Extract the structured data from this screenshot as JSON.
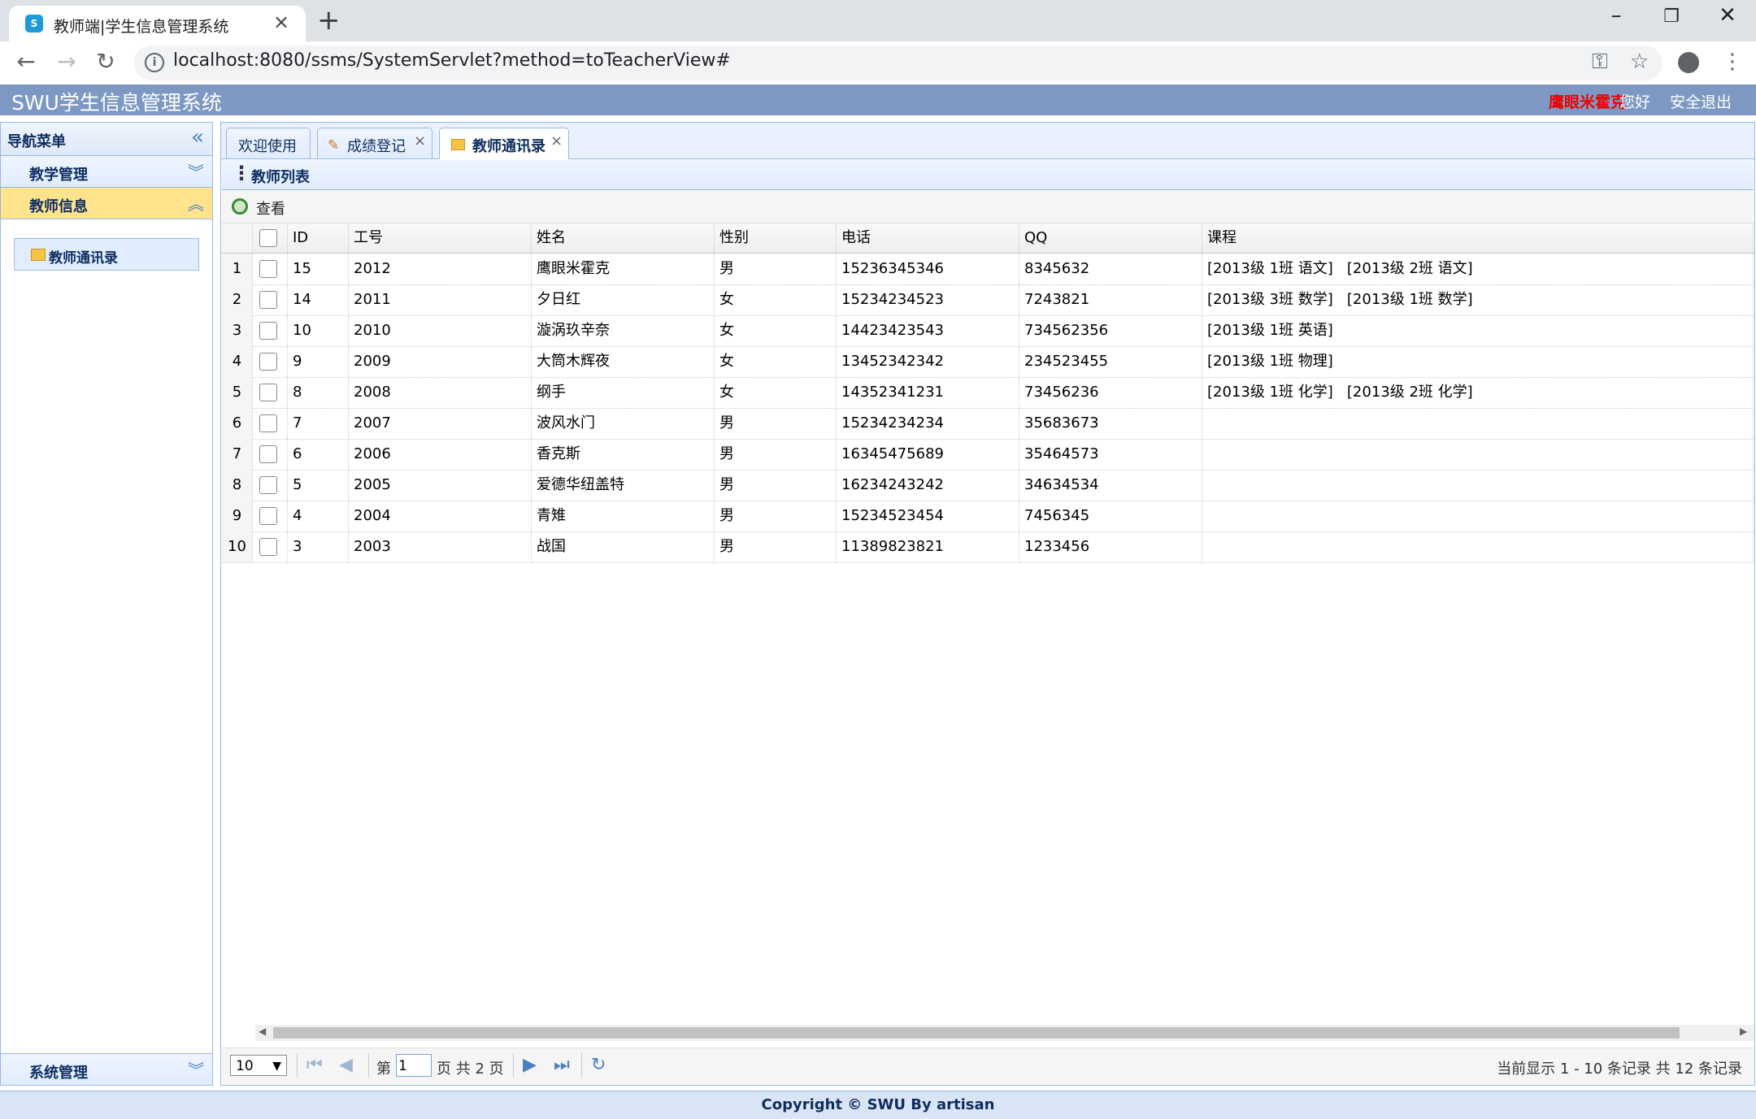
{
  "browser": {
    "tab_title": "教师端|学生信息管理系统",
    "url": "localhost:8080/ssms/SystemServlet?method=toTeacherView#"
  },
  "app": {
    "title": "SWU学生信息管理系统",
    "user_name": "鹰眼米霍克",
    "greeting": "您好",
    "logout": "安全退出"
  },
  "sidebar": {
    "title": "导航菜单",
    "sections": [
      {
        "label": "教学管理"
      },
      {
        "label": "教师信息"
      },
      {
        "label": "系统管理"
      }
    ],
    "active_item": "教师通讯录"
  },
  "tabs": [
    {
      "label": "欢迎使用"
    },
    {
      "label": "成绩登记"
    },
    {
      "label": "教师通讯录"
    }
  ],
  "panel": {
    "title": "教师列表",
    "toolbar_view": "查看"
  },
  "grid": {
    "columns": [
      "ID",
      "工号",
      "姓名",
      "性别",
      "电话",
      "QQ",
      "课程"
    ],
    "rows": [
      {
        "n": "1",
        "id": "15",
        "no": "2012",
        "name": "鹰眼米霍克",
        "sex": "男",
        "phone": "15236345346",
        "qq": "8345632",
        "course": "[2013级 1班 语文]   [2013级 2班 语文]"
      },
      {
        "n": "2",
        "id": "14",
        "no": "2011",
        "name": "夕日红",
        "sex": "女",
        "phone": "15234234523",
        "qq": "7243821",
        "course": "[2013级 3班 数学]   [2013级 1班 数学]"
      },
      {
        "n": "3",
        "id": "10",
        "no": "2010",
        "name": "漩涡玖辛奈",
        "sex": "女",
        "phone": "14423423543",
        "qq": "734562356",
        "course": "[2013级 1班 英语]"
      },
      {
        "n": "4",
        "id": "9",
        "no": "2009",
        "name": "大筒木辉夜",
        "sex": "女",
        "phone": "13452342342",
        "qq": "234523455",
        "course": "[2013级 1班 物理]"
      },
      {
        "n": "5",
        "id": "8",
        "no": "2008",
        "name": "纲手",
        "sex": "女",
        "phone": "14352341231",
        "qq": "73456236",
        "course": "[2013级 1班 化学]   [2013级 2班 化学]"
      },
      {
        "n": "6",
        "id": "7",
        "no": "2007",
        "name": "波风水门",
        "sex": "男",
        "phone": "15234234234",
        "qq": "35683673",
        "course": ""
      },
      {
        "n": "7",
        "id": "6",
        "no": "2006",
        "name": "香克斯",
        "sex": "男",
        "phone": "16345475689",
        "qq": "35464573",
        "course": ""
      },
      {
        "n": "8",
        "id": "5",
        "no": "2005",
        "name": "爱德华纽盖特",
        "sex": "男",
        "phone": "16234243242",
        "qq": "34634534",
        "course": ""
      },
      {
        "n": "9",
        "id": "4",
        "no": "2004",
        "name": "青雉",
        "sex": "男",
        "phone": "15234523454",
        "qq": "7456345",
        "course": ""
      },
      {
        "n": "10",
        "id": "3",
        "no": "2003",
        "name": "战国",
        "sex": "男",
        "phone": "11389823821",
        "qq": "1233456",
        "course": ""
      }
    ]
  },
  "pager": {
    "page_size": "10",
    "page_prefix": "第",
    "page_value": "1",
    "page_suffix": "页 共 2 页",
    "summary": "当前显示 1 - 10 条记录 共 12 条记录"
  },
  "footer": "Copyright © SWU By artisan",
  "colors": {
    "accent": "#95b8e7",
    "header": "#7d99c3",
    "user": "#ee0000",
    "active_section": "#ffe48d"
  }
}
